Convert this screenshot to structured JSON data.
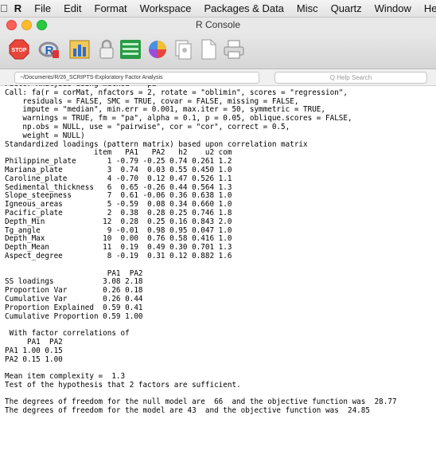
{
  "menubar": {
    "apple_icon": "apple-icon",
    "app": "R",
    "items": [
      "File",
      "Edit",
      "Format",
      "Workspace",
      "Packages & Data",
      "Misc",
      "Quartz",
      "Window",
      "Help"
    ]
  },
  "window": {
    "title": "R Console"
  },
  "toolbar": {
    "buttons": [
      "stop-icon",
      "r-source-icon",
      "chart-icon",
      "lock-icon",
      "list-icon",
      "color-wheel-icon",
      "copy-icon",
      "new-document-icon",
      "print-icon"
    ]
  },
  "pathbar": {
    "path": "~/Documents/R/26_SCRIPTS-Exploratory Factor Analysis",
    "search_placeholder": "Q  Help Search"
  },
  "colors": {
    "close": "#fe5f57",
    "minimize": "#febc2e",
    "maximize": "#28c840",
    "stop": "#e8463b"
  },
  "console": {
    "lines": [
      "Factor Analysis using method =  pa",
      "Call: fa(r = corMat, nfactors = 2, rotate = \"oblimin\", scores = \"regression\",",
      "    residuals = FALSE, SMC = TRUE, covar = FALSE, missing = FALSE,",
      "    impute = \"median\", min.err = 0.001, max.iter = 50, symmetric = TRUE,",
      "    warnings = TRUE, fm = \"pa\", alpha = 0.1, p = 0.05, oblique.scores = FALSE,",
      "    np.obs = NULL, use = \"pairwise\", cor = \"cor\", correct = 0.5,",
      "    weight = NULL)",
      "Standardized loadings (pattern matrix) based upon correlation matrix",
      "                    item   PA1   PA2   h2    u2 com",
      "Philippine_plate       1 -0.79 -0.25 0.74 0.261 1.2",
      "Mariana_plate          3  0.74  0.03 0.55 0.450 1.0",
      "Caroline_plate         4 -0.70  0.12 0.47 0.526 1.1",
      "Sedimental_thickness   6  0.65 -0.26 0.44 0.564 1.3",
      "Slope_steepness        7  0.61 -0.06 0.36 0.638 1.0",
      "Igneous_areas          5 -0.59  0.08 0.34 0.660 1.0",
      "Pacific_plate          2  0.38  0.28 0.25 0.746 1.8",
      "Depth_Min             12  0.28  0.25 0.16 0.843 2.0",
      "Tg_angle               9 -0.01  0.98 0.95 0.047 1.0",
      "Depth_Max             10  0.00  0.76 0.58 0.416 1.0",
      "Depth_Mean            11  0.19  0.49 0.30 0.701 1.3",
      "Aspect_degree          8 -0.19  0.31 0.12 0.882 1.6",
      "",
      "                       PA1  PA2",
      "SS loadings           3.08 2.18",
      "Proportion Var        0.26 0.18",
      "Cumulative Var        0.26 0.44",
      "Proportion Explained  0.59 0.41",
      "Cumulative Proportion 0.59 1.00",
      "",
      " With factor correlations of",
      "     PA1  PA2",
      "PA1 1.00 0.15",
      "PA2 0.15 1.00",
      "",
      "Mean item complexity =  1.3",
      "Test of the hypothesis that 2 factors are sufficient.",
      "",
      "The degrees of freedom for the null model are  66  and the objective function was  28.77",
      "The degrees of freedom for the model are 43  and the objective function was  24.85"
    ]
  }
}
